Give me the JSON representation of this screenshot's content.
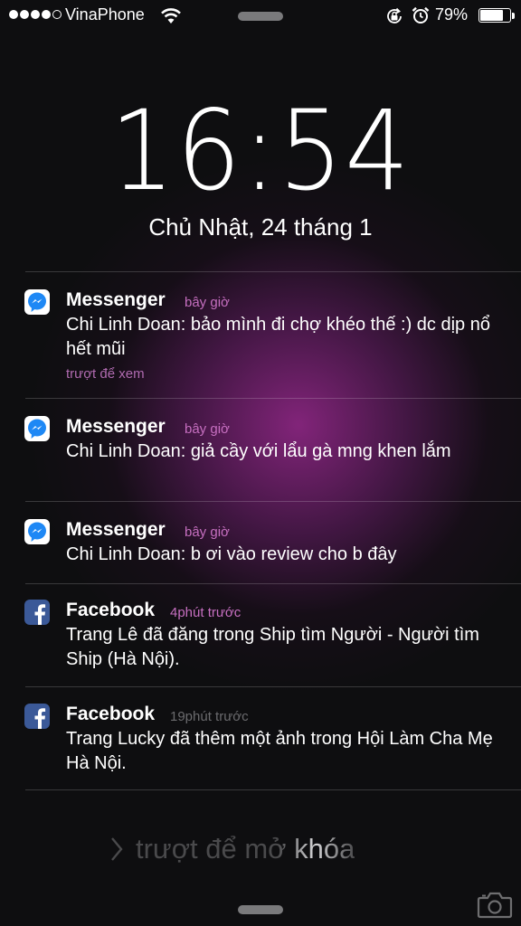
{
  "status_bar": {
    "carrier": "VinaPhone",
    "signal_bars_filled": 4,
    "signal_bars_total": 5,
    "battery_percent": "79%",
    "battery_level": 0.79,
    "icons": [
      "wifi-icon",
      "rotation-lock-icon",
      "alarm-icon",
      "battery-icon"
    ]
  },
  "lock_screen": {
    "time": "16:54",
    "date": "Chủ Nhật, 24 tháng 1",
    "unlock_label": "trượt để mở khóa"
  },
  "notifications": [
    {
      "app": "Messenger",
      "icon": "messenger-icon",
      "time": "bây giờ",
      "body": "Chi Linh Doan: bảo mình đi chợ khéo thế :) dc dịp nổ hết mũi",
      "hint": "trượt để xem"
    },
    {
      "app": "Messenger",
      "icon": "messenger-icon",
      "time": "bây giờ",
      "body": "Chi Linh Doan: giả cầy với lẩu gà mng khen lắm"
    },
    {
      "app": "Messenger",
      "icon": "messenger-icon",
      "time": "bây giờ",
      "body": "Chi Linh Doan: b ơi vào review cho b đây"
    },
    {
      "app": "Facebook",
      "icon": "facebook-icon",
      "time": "4phút trước",
      "body": "Trang Lê đã đăng trong Ship tìm Người - Người tìm Ship (Hà Nội)."
    },
    {
      "app": "Facebook",
      "icon": "facebook-icon",
      "time": "19phút trước",
      "body": "Trang Lucky đã thêm một ảnh trong Hội Làm Cha Mẹ Hà Nội."
    }
  ],
  "colors": {
    "accent_time": "#c66fc0",
    "dim_time": "#6b6b6e",
    "facebook_blue": "#3b5998",
    "messenger_blue": "#1e88f5"
  }
}
